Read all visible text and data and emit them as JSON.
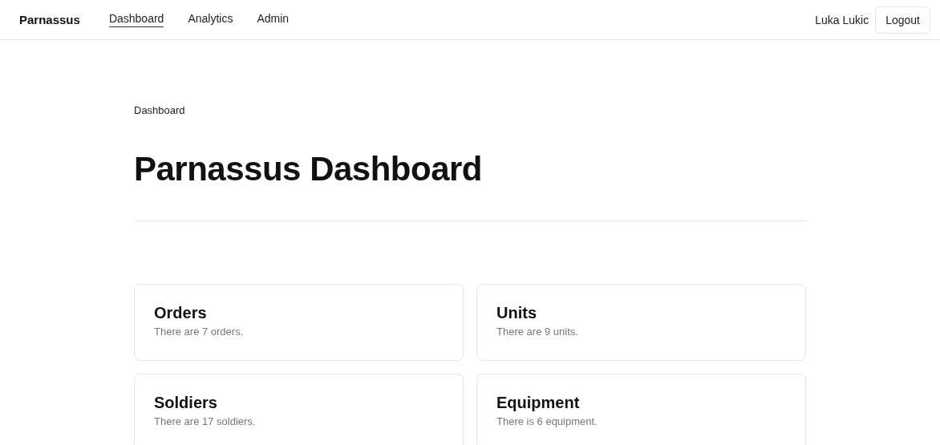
{
  "nav": {
    "brand": "Parnassus",
    "links": [
      {
        "label": "Dashboard",
        "selected": true
      },
      {
        "label": "Analytics",
        "selected": false
      },
      {
        "label": "Admin",
        "selected": false
      }
    ],
    "user": "Luka Lukic",
    "logout": "Logout"
  },
  "breadcrumb": "Dashboard",
  "title": "Parnassus Dashboard",
  "cards": [
    {
      "title": "Orders",
      "description": "There are 7 orders."
    },
    {
      "title": "Units",
      "description": "There are 9 units."
    },
    {
      "title": "Soldiers",
      "description": "There are 17 soldiers."
    },
    {
      "title": "Equipment",
      "description": "There is 6 equipment."
    }
  ]
}
